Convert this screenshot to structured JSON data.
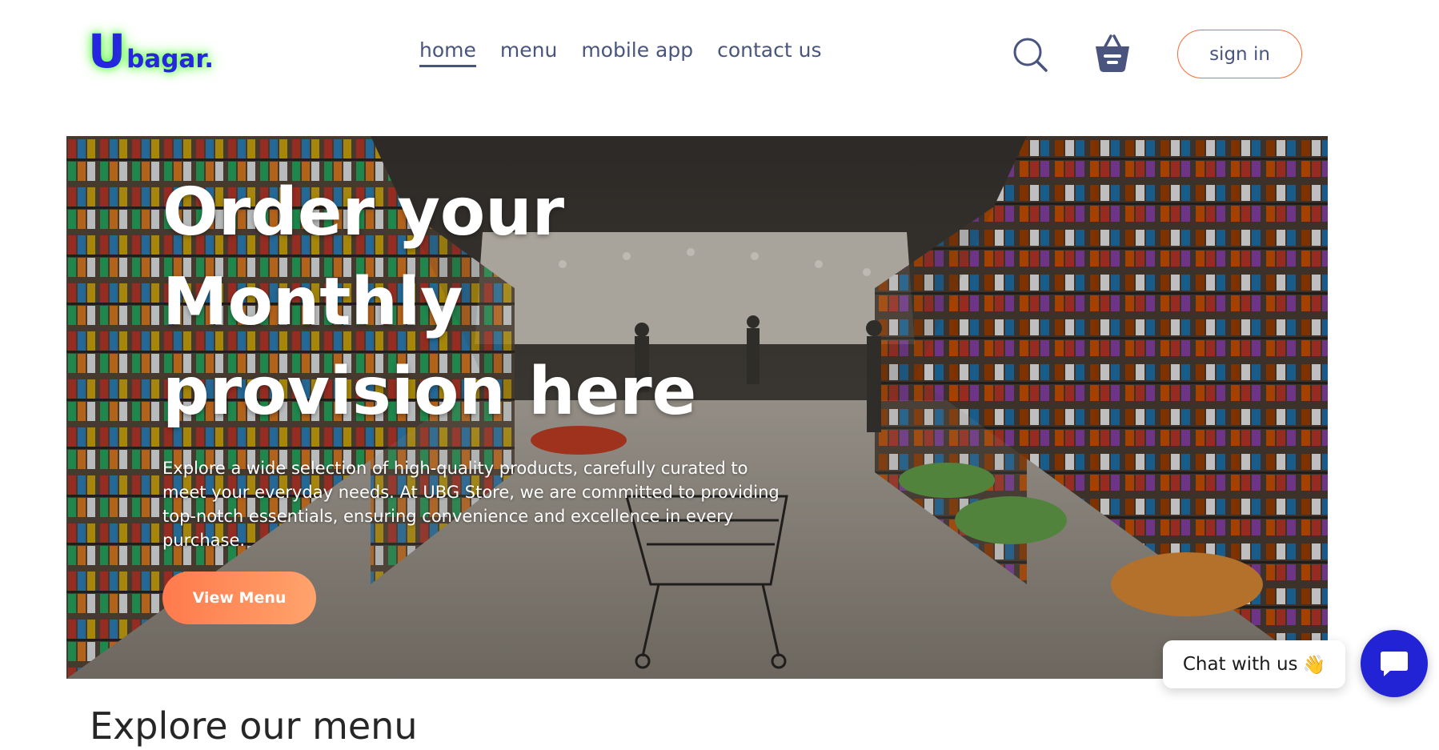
{
  "navbar": {
    "logo": {
      "big": "U",
      "small": "bagar."
    },
    "links": [
      {
        "label": "home",
        "active": true
      },
      {
        "label": "menu",
        "active": false
      },
      {
        "label": "mobile app",
        "active": false
      },
      {
        "label": "contact us",
        "active": false
      }
    ],
    "icons": {
      "search": "search-icon",
      "cart": "basket-icon"
    },
    "signin_label": "sign in"
  },
  "hero": {
    "title": "Order your Monthly provision here",
    "description": "Explore a wide selection of high-quality products, carefully curated to meet your everyday needs. At UBG Store, we are committed to providing top-notch essentials, ensuring convenience and excellence in every purchase.",
    "button_label": "View Menu"
  },
  "section": {
    "title": "Explore our menu"
  },
  "chat": {
    "label": "Chat with us",
    "emoji": "👋",
    "icon": "chat-bubble-icon"
  },
  "colors": {
    "brand": "#2626e0",
    "logo_glow": "#39ff14",
    "accent": "#ff6a33",
    "text": "#49557e",
    "chat_button": "#2323d6"
  }
}
